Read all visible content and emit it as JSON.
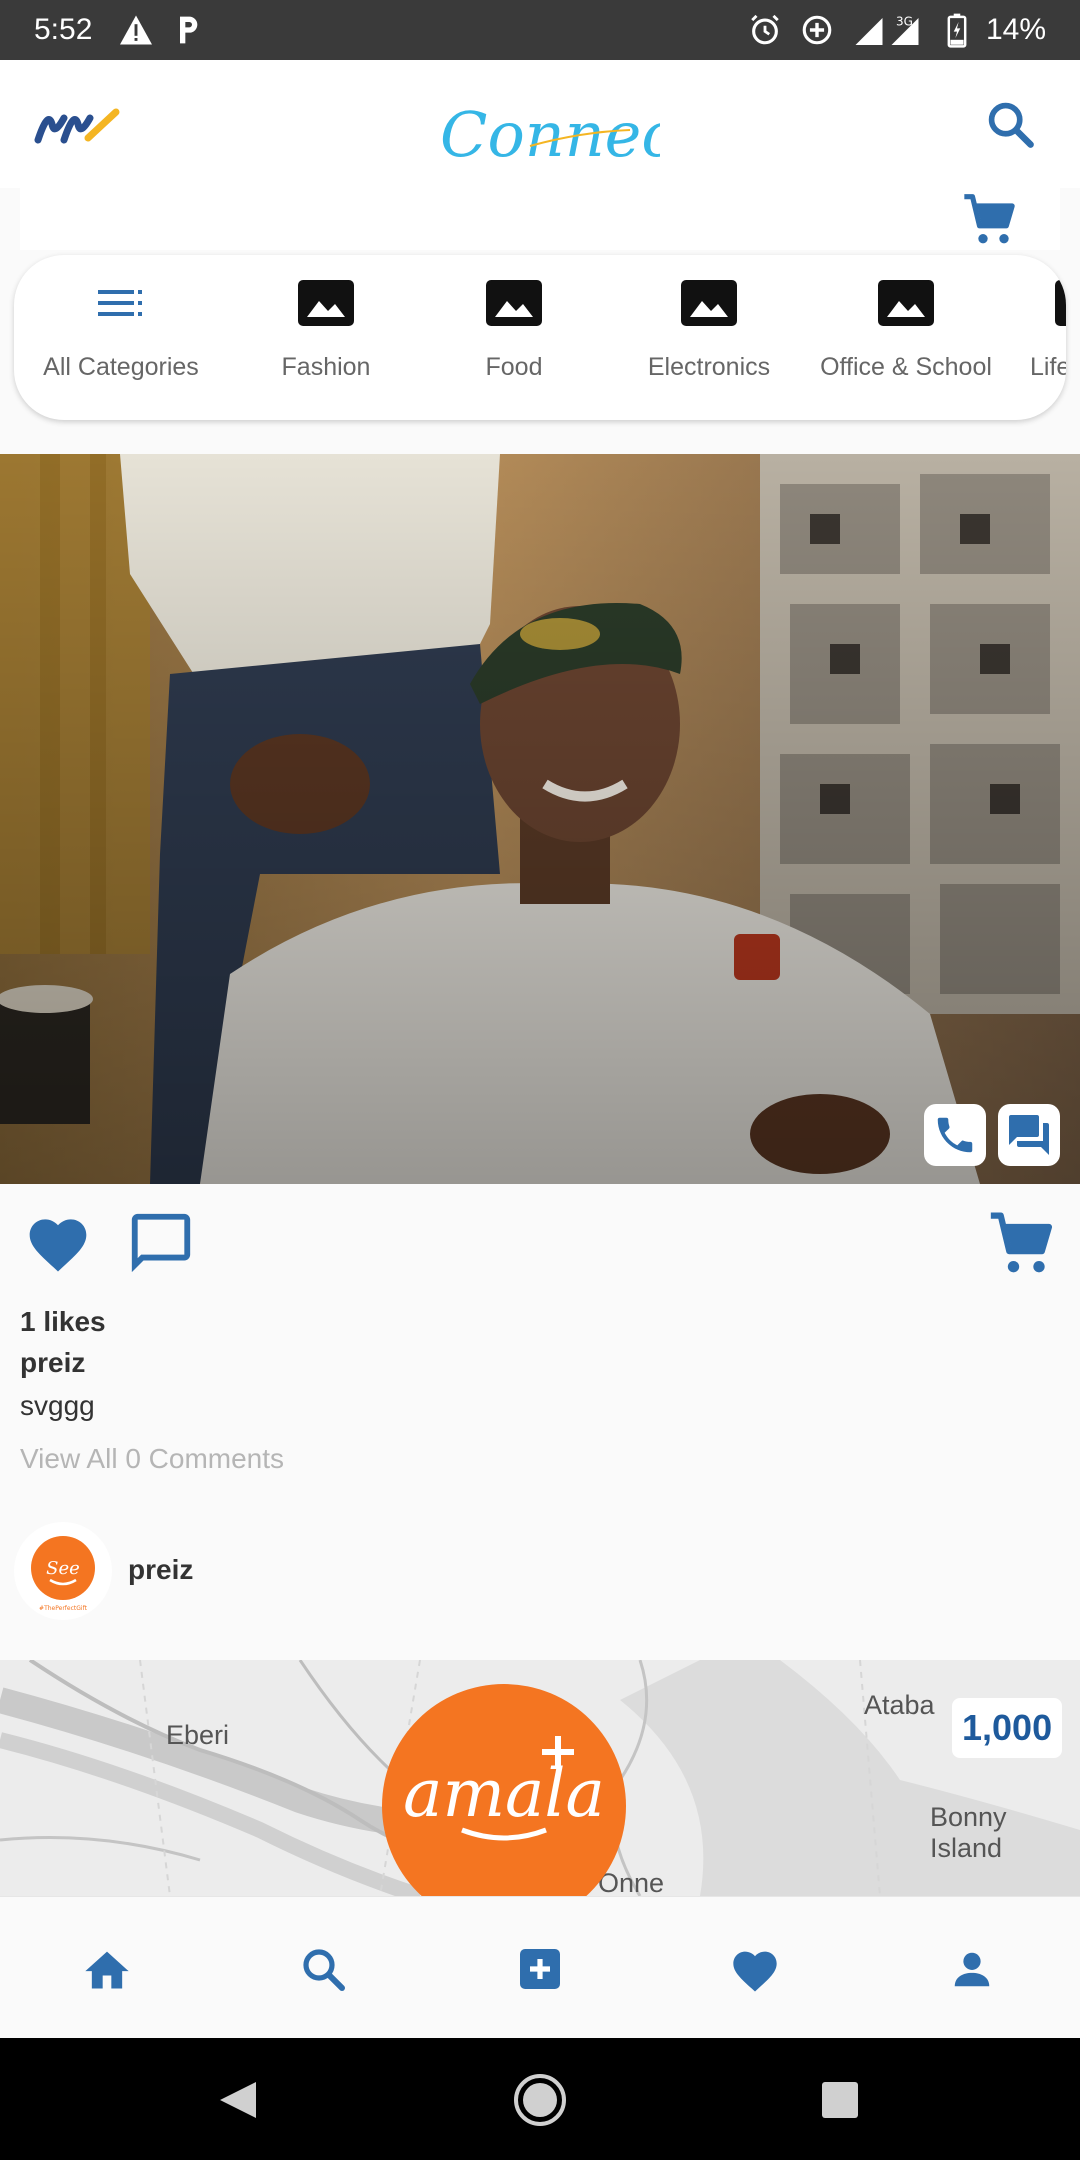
{
  "status_bar": {
    "time": "5:52",
    "network": "3G",
    "battery": "14%",
    "icons": [
      "warning-icon",
      "parking-icon",
      "alarm-icon",
      "data-saver-icon",
      "signal-icon",
      "battery-icon"
    ]
  },
  "app_bar": {
    "brand": "Connect",
    "logo_icon": "nn-logo",
    "search_icon": "search-icon",
    "cart_icon": "cart-icon"
  },
  "categories": [
    {
      "label": "All Categories",
      "icon": "list-icon"
    },
    {
      "label": "Fashion",
      "icon": "image-icon"
    },
    {
      "label": "Food",
      "icon": "image-icon"
    },
    {
      "label": "Electronics",
      "icon": "image-icon"
    },
    {
      "label": "Office & School",
      "icon": "image-icon"
    },
    {
      "label": "Life",
      "icon": "image-icon"
    }
  ],
  "post": {
    "likes": "1 likes",
    "username": "preiz",
    "caption": "svggg",
    "view_comments": "View All 0 Comments",
    "author": "preiz",
    "avatar_text": "See",
    "avatar_subtext": "#ThePerfectGift",
    "actions": [
      "heart-icon",
      "comment-icon",
      "cart-icon",
      "phone-icon",
      "chat-icon"
    ]
  },
  "map_card": {
    "labels": [
      "Eberi",
      "Ataba",
      "Bonny Island",
      "Onne"
    ],
    "price": "1,000",
    "logo_text": "amala"
  },
  "bottom_nav": [
    "home-icon",
    "search-icon",
    "add-icon",
    "heart-icon",
    "profile-icon"
  ],
  "colors": {
    "primary": "#2f6ead",
    "accent_cyan": "#35b6e6",
    "accent_orange": "#f47521",
    "status_bar": "#3a3a3a"
  }
}
